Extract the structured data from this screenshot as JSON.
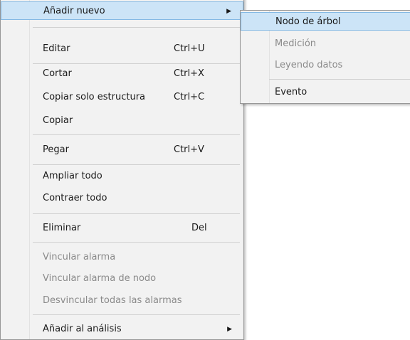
{
  "context_menu": {
    "items": [
      {
        "label": "Añadir nuevo",
        "shortcut": "",
        "has_submenu": true,
        "disabled": false
      },
      {
        "label": "Editar",
        "shortcut": "Ctrl+U",
        "has_submenu": false,
        "disabled": false
      },
      {
        "label": "Cortar",
        "shortcut": "Ctrl+X",
        "has_submenu": false,
        "disabled": false
      },
      {
        "label": "Copiar solo estructura",
        "shortcut": "Ctrl+C",
        "has_submenu": false,
        "disabled": false
      },
      {
        "label": "Copiar",
        "shortcut": "",
        "has_submenu": false,
        "disabled": false
      },
      {
        "label": "Pegar",
        "shortcut": "Ctrl+V",
        "has_submenu": false,
        "disabled": false
      },
      {
        "label": "Ampliar todo",
        "shortcut": "",
        "has_submenu": false,
        "disabled": false
      },
      {
        "label": "Contraer todo",
        "shortcut": "",
        "has_submenu": false,
        "disabled": false
      },
      {
        "label": "Eliminar",
        "shortcut": "Del",
        "has_submenu": false,
        "disabled": false
      },
      {
        "label": "Vincular alarma",
        "shortcut": "",
        "has_submenu": false,
        "disabled": true
      },
      {
        "label": "Vincular alarma de nodo",
        "shortcut": "",
        "has_submenu": false,
        "disabled": true
      },
      {
        "label": "Desvincular todas las alarmas",
        "shortcut": "",
        "has_submenu": false,
        "disabled": true
      },
      {
        "label": "Añadir al análisis",
        "shortcut": "",
        "has_submenu": true,
        "disabled": false
      }
    ]
  },
  "submenu": {
    "items": [
      {
        "label": "Nodo de árbol",
        "disabled": false
      },
      {
        "label": "Medición",
        "disabled": true
      },
      {
        "label": "Leyendo datos",
        "disabled": true
      },
      {
        "label": "Evento",
        "disabled": false
      }
    ]
  },
  "icons": {
    "submenu_arrow": "triangle-right-icon"
  },
  "colors": {
    "highlight": "#cce4f7",
    "highlight_border": "#84b9e4",
    "disabled_text": "#8a8a8a",
    "menu_bg": "#f2f2f2"
  }
}
